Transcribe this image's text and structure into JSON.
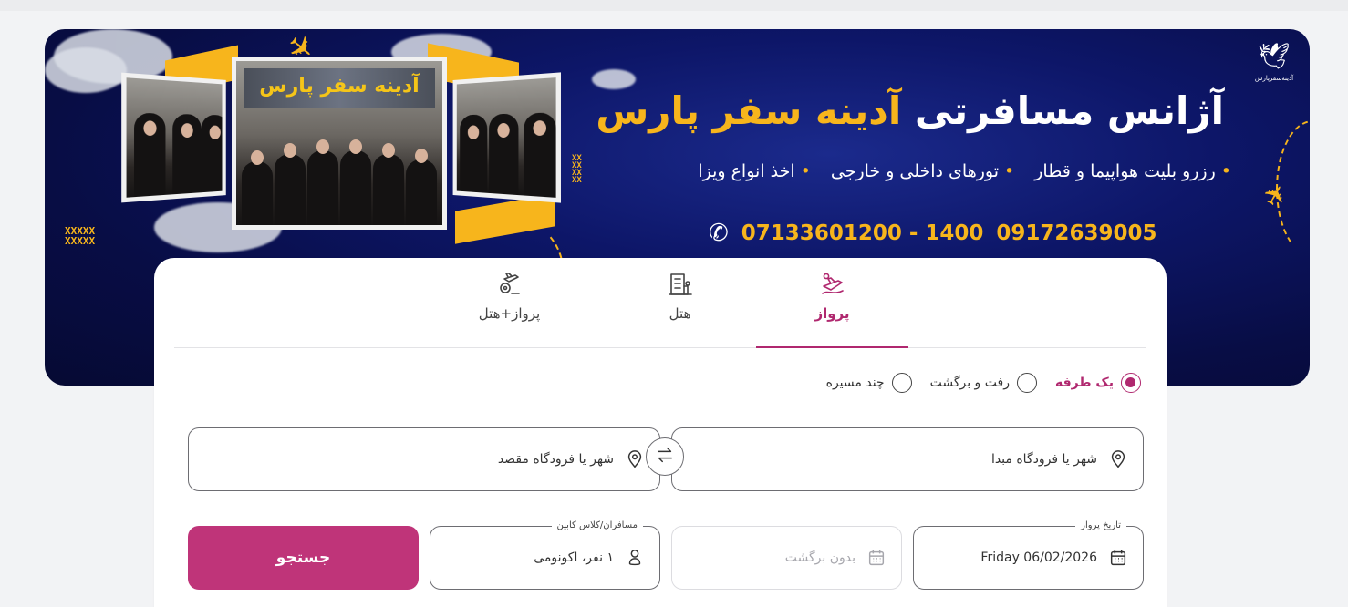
{
  "banner": {
    "title_part1": "آژانس مسافرتی",
    "title_part2": "آدینه سفر پارس",
    "services": [
      "رزرو بلیت هواپیما و قطار",
      "تورهای داخلی و خارجی",
      "اخذ انواع ویزا"
    ],
    "phone_1": "07133601200 - 1400",
    "phone_2": "09172639005",
    "photo_sign": "آدینه سفر پارس",
    "logo_text": "آدینه‌سفرپارس",
    "accent_color": "#f7b51c",
    "background_color": "#0d1668"
  },
  "tabs": [
    {
      "label": "پرواز",
      "icon": "plane-route-icon",
      "active": true
    },
    {
      "label": "هتل",
      "icon": "hotel-building-icon",
      "active": false
    },
    {
      "label": "پرواز+هتل",
      "icon": "flight-hotel-icon",
      "active": false
    }
  ],
  "trip_types": [
    {
      "label": "یک طرفه",
      "checked": true
    },
    {
      "label": "رفت و برگشت",
      "checked": false
    },
    {
      "label": "چند مسیره",
      "checked": false
    }
  ],
  "search": {
    "origin_placeholder": "شهر یا فرودگاه مبدا",
    "destination_placeholder": "شهر یا فرودگاه مقصد",
    "departure_label": "تاریخ پرواز",
    "departure_value": "Friday 06/02/2026",
    "return_placeholder": "بدون برگشت",
    "passengers_label": "مسافران/کلاس کابین",
    "passengers_value": "۱ نفر، اکونومی",
    "search_label": "جستجو"
  },
  "theme": {
    "primary_color": "#bf3479",
    "tab_active_color": "#b0286f"
  }
}
